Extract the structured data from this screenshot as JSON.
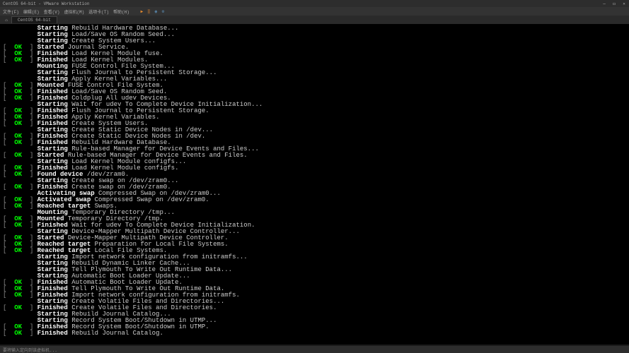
{
  "window": {
    "title": "CentOS 64-bit - VMware Workstation",
    "minimize": "—",
    "maximize": "◻",
    "close": "✕"
  },
  "menubar": {
    "file": "文件(F)",
    "edit": "编辑(E)",
    "view": "查看(V)",
    "vm": "虚拟机(M)",
    "tabs": "选项卡(T)",
    "help": "帮助(H)"
  },
  "tabs": {
    "home_icon": "⌂",
    "active": "CentOS 64-bit"
  },
  "toolbar": {
    "play": "▶",
    "pause": "‖",
    "snapshot": "◉",
    "settings": "⚙"
  },
  "statusbar": {
    "text": "要将输入定向到该虚拟机..."
  },
  "lines": [
    {
      "s": null,
      "a": "Starting",
      "m": "Rebuild Hardware Database..."
    },
    {
      "s": null,
      "a": "Starting",
      "m": "Load/Save OS Random Seed..."
    },
    {
      "s": null,
      "a": "Starting",
      "m": "Create System Users..."
    },
    {
      "s": "OK",
      "a": "Started",
      "m": "Journal Service."
    },
    {
      "s": "OK",
      "a": "Finished",
      "m": "Load Kernel Module fuse."
    },
    {
      "s": "OK",
      "a": "Finished",
      "m": "Load Kernel Modules."
    },
    {
      "s": null,
      "a": "Mounting",
      "m": "FUSE Control File System..."
    },
    {
      "s": null,
      "a": "Starting",
      "m": "Flush Journal to Persistent Storage..."
    },
    {
      "s": null,
      "a": "Starting",
      "m": "Apply Kernel Variables..."
    },
    {
      "s": "OK",
      "a": "Mounted",
      "m": "FUSE Control File System."
    },
    {
      "s": "OK",
      "a": "Finished",
      "m": "Load/Save OS Random Seed."
    },
    {
      "s": "OK",
      "a": "Finished",
      "m": "Coldplug All udev Devices."
    },
    {
      "s": null,
      "a": "Starting",
      "m": "Wait for udev To Complete Device Initialization..."
    },
    {
      "s": "OK",
      "a": "Finished",
      "m": "Flush Journal to Persistent Storage."
    },
    {
      "s": "OK",
      "a": "Finished",
      "m": "Apply Kernel Variables."
    },
    {
      "s": "OK",
      "a": "Finished",
      "m": "Create System Users."
    },
    {
      "s": null,
      "a": "Starting",
      "m": "Create Static Device Nodes in /dev..."
    },
    {
      "s": "OK",
      "a": "Finished",
      "m": "Create Static Device Nodes in /dev."
    },
    {
      "s": "OK",
      "a": "Finished",
      "m": "Rebuild Hardware Database."
    },
    {
      "s": null,
      "a": "Starting",
      "m": "Rule-based Manager for Device Events and Files..."
    },
    {
      "s": "OK",
      "a": "Started",
      "m": "Rule-based Manager for Device Events and Files."
    },
    {
      "s": null,
      "a": "Starting",
      "m": "Load Kernel Module configfs..."
    },
    {
      "s": "OK",
      "a": "Finished",
      "m": "Load Kernel Module configfs."
    },
    {
      "s": "OK",
      "a": "Found device",
      "m": "/dev/zram0."
    },
    {
      "s": null,
      "a": "Starting",
      "m": "Create swap on /dev/zram0..."
    },
    {
      "s": "OK",
      "a": "Finished",
      "m": "Create swap on /dev/zram0."
    },
    {
      "s": null,
      "a": "Activating swap",
      "m": "Compressed Swap on /dev/zram0..."
    },
    {
      "s": "OK",
      "a": "Activated swap",
      "m": "Compressed Swap on /dev/zram0."
    },
    {
      "s": "OK",
      "a": "Reached target",
      "m": "Swaps."
    },
    {
      "s": null,
      "a": "Mounting",
      "m": "Temporary Directory /tmp..."
    },
    {
      "s": "OK",
      "a": "Mounted",
      "m": "Temporary Directory /tmp."
    },
    {
      "s": "OK",
      "a": "Finished",
      "m": "Wait for udev To Complete Device Initialization."
    },
    {
      "s": null,
      "a": "Starting",
      "m": "Device-Mapper Multipath Device Controller..."
    },
    {
      "s": "OK",
      "a": "Started",
      "m": "Device-Mapper Multipath Device Controller."
    },
    {
      "s": "OK",
      "a": "Reached target",
      "m": "Preparation for Local File Systems."
    },
    {
      "s": "OK",
      "a": "Reached target",
      "m": "Local File Systems."
    },
    {
      "s": null,
      "a": "Starting",
      "m": "Import network configuration from initramfs..."
    },
    {
      "s": null,
      "a": "Starting",
      "m": "Rebuild Dynamic Linker Cache..."
    },
    {
      "s": null,
      "a": "Starting",
      "m": "Tell Plymouth To Write Out Runtime Data..."
    },
    {
      "s": null,
      "a": "Starting",
      "m": "Automatic Boot Loader Update..."
    },
    {
      "s": "OK",
      "a": "Finished",
      "m": "Automatic Boot Loader Update."
    },
    {
      "s": "OK",
      "a": "Finished",
      "m": "Tell Plymouth To Write Out Runtime Data."
    },
    {
      "s": "OK",
      "a": "Finished",
      "m": "Import network configuration from initramfs."
    },
    {
      "s": null,
      "a": "Starting",
      "m": "Create Volatile Files and Directories..."
    },
    {
      "s": "OK",
      "a": "Finished",
      "m": "Create Volatile Files and Directories."
    },
    {
      "s": null,
      "a": "Starting",
      "m": "Rebuild Journal Catalog..."
    },
    {
      "s": null,
      "a": "Starting",
      "m": "Record System Boot/Shutdown in UTMP..."
    },
    {
      "s": "OK",
      "a": "Finished",
      "m": "Record System Boot/Shutdown in UTMP."
    },
    {
      "s": "OK",
      "a": "Finished",
      "m": "Rebuild Journal Catalog."
    }
  ]
}
